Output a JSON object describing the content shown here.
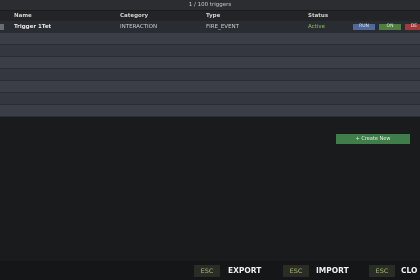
{
  "summary": {
    "count_text": "1 / 100 triggers"
  },
  "table": {
    "headers": {
      "name": "Name",
      "category": "Category",
      "type": "Type",
      "status": "Status"
    },
    "rows": [
      {
        "name": "Trigger 1Tet",
        "category": "INTERACTION",
        "type": "FIRE_EVENT",
        "status": "Active",
        "actions": {
          "run": "RUN",
          "on": "ON",
          "delete": "DE"
        }
      }
    ]
  },
  "create_button": {
    "label": "+ Create New"
  },
  "footer": {
    "shortcuts": [
      {
        "key": "ESC",
        "label": "EXPORT"
      },
      {
        "key": "ESC",
        "label": "IMPORT"
      },
      {
        "key": "ESC",
        "label": "CLO"
      }
    ]
  },
  "colors": {
    "status_active": "#8ec45a",
    "run": "#4e6a9a",
    "on": "#4f7f3f",
    "delete": "#a23a3a",
    "create": "#3f7d4a"
  }
}
